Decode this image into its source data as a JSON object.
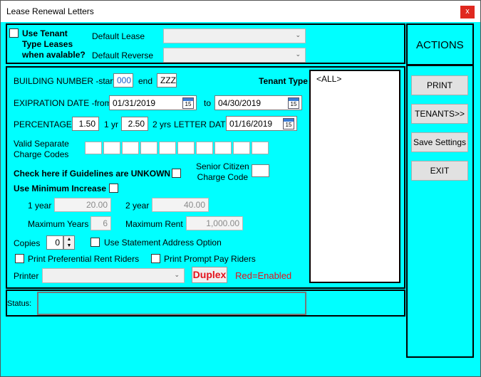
{
  "window": {
    "title": "Lease Renewal Letters",
    "close_glyph": "x"
  },
  "top": {
    "use_tenant_label_1": "Use Tenant",
    "use_tenant_label_2": "Type Leases",
    "use_tenant_label_3": "when avalable?",
    "default_lease_label": "Default Lease",
    "default_reverse_label": "Default Reverse"
  },
  "actions": {
    "header": "ACTIONS",
    "print": "PRINT",
    "tenants": "TENANTS>>",
    "save_settings": "Save Settings",
    "exit": "EXIT"
  },
  "form": {
    "building_label": "BUILDING NUMBER -start",
    "building_start": "000",
    "end_label": "end",
    "building_end": "ZZZ",
    "tenant_type_label": "Tenant Type",
    "tenant_type_item": "<ALL>",
    "exp_label": "EXIPRATION DATE -from",
    "exp_from": "01/31/2019",
    "to_label": "to",
    "exp_to": "04/30/2019",
    "pct_label": "PERCENTAGES",
    "pct_1yr": "1.50",
    "yr1_label": "1 yr",
    "pct_2yr": "2.50",
    "yr2_label": "2 yrs",
    "letter_date_label": "LETTER DATE",
    "letter_date": "01/16/2019",
    "cal_glyph": "15",
    "valid_codes_1": "Valid Separate",
    "valid_codes_2": "Charge Codes",
    "guidelines_label": "Check here if Guidelines are UNKOWN",
    "senior_label_1": "Senior Citizen",
    "senior_label_2": "Charge Code",
    "min_increase_label": "Use Minimum Increase",
    "one_year_label": "1 year",
    "one_year_val": "20.00",
    "two_year_label": "2 year",
    "two_year_val": "40.00",
    "max_years_label": "Maximum Years",
    "max_years_val": "6",
    "max_rent_label": "Maximum Rent",
    "max_rent_val": "1,000.00",
    "copies_label": "Copies",
    "copies_val": "0",
    "stmt_addr_label": "Use Statement Address Option",
    "pref_rent_label": "Print Preferential Rent Riders",
    "prompt_pay_label": "Print Prompt Pay Riders",
    "printer_label": "Printer",
    "duplex_label": "Duplex",
    "red_enabled_label": "Red=Enabled"
  },
  "status": {
    "label": "Status:"
  },
  "colors": {
    "background": "#00ffff",
    "duplex": "#e3111b"
  }
}
